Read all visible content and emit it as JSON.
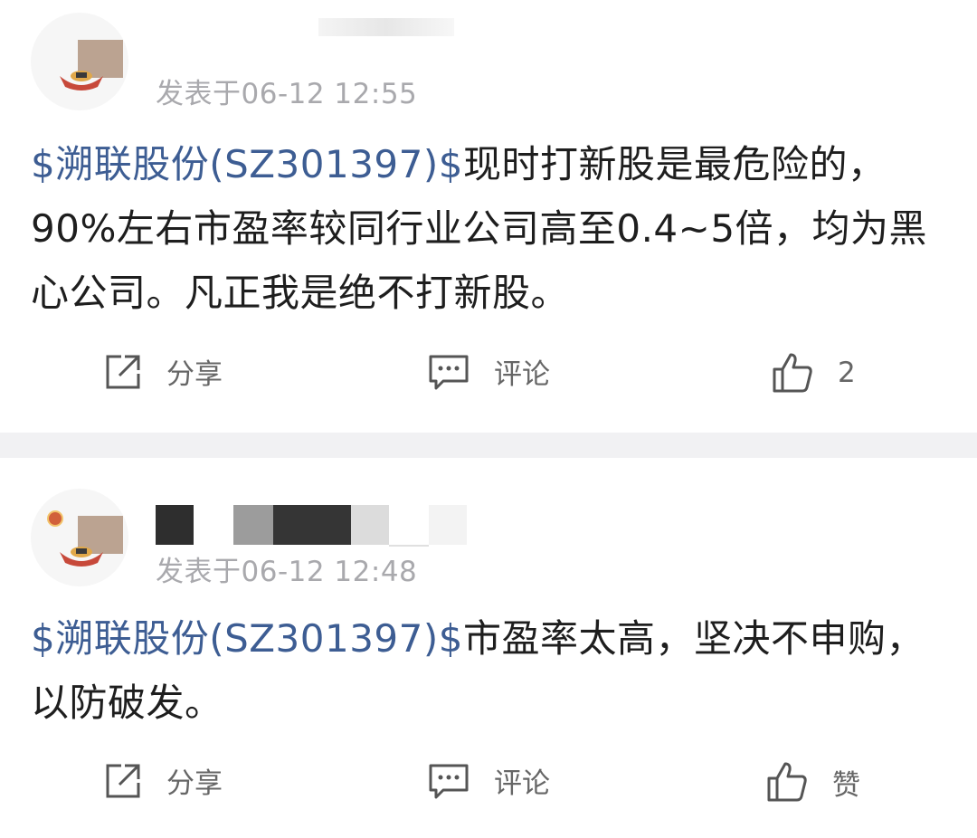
{
  "posts": [
    {
      "meta": "发表于06-12 12:55",
      "stock_tag": "$溯联股份(SZ301397)$",
      "text": "现时打新股是最危险的，90%左右市盈率较同行业公司高至0.4~5倍，均为黑心公司。凡正我是绝不打新股。",
      "actions": {
        "share": "分享",
        "comment": "评论",
        "like": "2"
      }
    },
    {
      "meta": "发表于06-12 12:48",
      "stock_tag": "$溯联股份(SZ301397)$",
      "text": "市盈率太高，坚决不申购，以防破发。",
      "actions": {
        "share": "分享",
        "comment": "评论",
        "like": "赞"
      }
    }
  ],
  "colors": {
    "link": "#3d5d93",
    "meta": "#a9a9ad",
    "divider": "#f1f1f3"
  },
  "icons": [
    "share-icon",
    "comment-icon",
    "thumbs-up-icon"
  ]
}
